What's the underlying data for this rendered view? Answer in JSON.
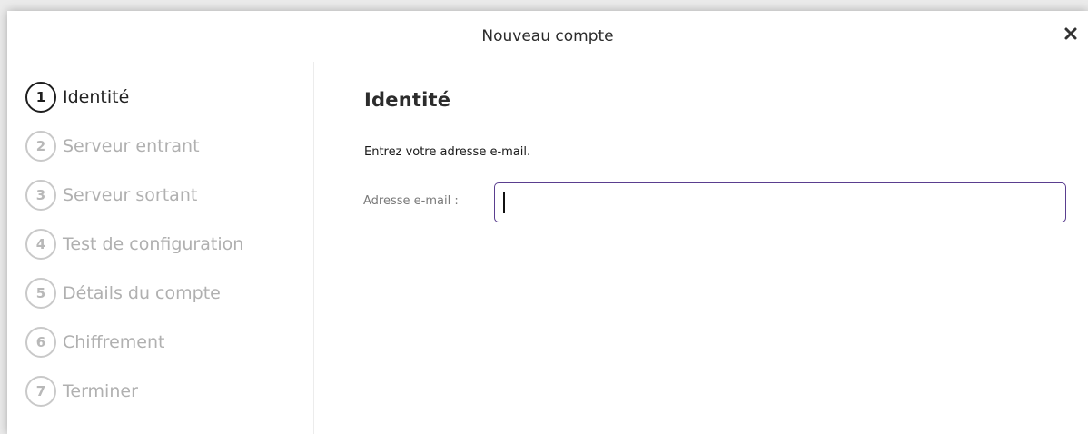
{
  "dialog": {
    "title": "Nouveau compte",
    "close_icon": "close-icon"
  },
  "sidebar": {
    "active_step": 1,
    "steps": [
      {
        "number": "1",
        "label": "Identité"
      },
      {
        "number": "2",
        "label": "Serveur entrant"
      },
      {
        "number": "3",
        "label": "Serveur sortant"
      },
      {
        "number": "4",
        "label": "Test de configuration"
      },
      {
        "number": "5",
        "label": "Détails du compte"
      },
      {
        "number": "6",
        "label": "Chiffrement"
      },
      {
        "number": "7",
        "label": "Terminer"
      }
    ]
  },
  "content": {
    "heading": "Identité",
    "instruction": "Entrez votre adresse e-mail.",
    "email": {
      "label": "Adresse e-mail :",
      "value": "",
      "placeholder": ""
    }
  },
  "colors": {
    "accent_border": "#5a3e8f",
    "active_text": "#222222",
    "inactive_text": "#b0b0b0"
  }
}
